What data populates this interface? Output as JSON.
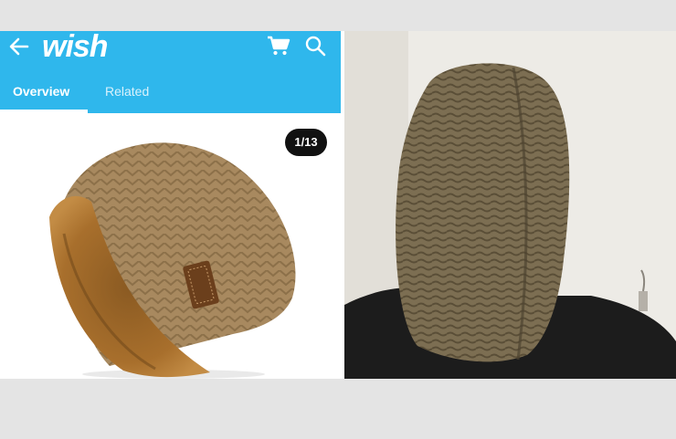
{
  "app": {
    "logo": "wish",
    "icons": {
      "back": "back-arrow-icon",
      "cart": "cart-icon",
      "search": "search-icon"
    },
    "accent_color": "#2fb7ec"
  },
  "tabs": [
    {
      "label": "Overview",
      "active": true
    },
    {
      "label": "Related",
      "active": false
    }
  ],
  "gallery": {
    "counter": "1/13"
  }
}
